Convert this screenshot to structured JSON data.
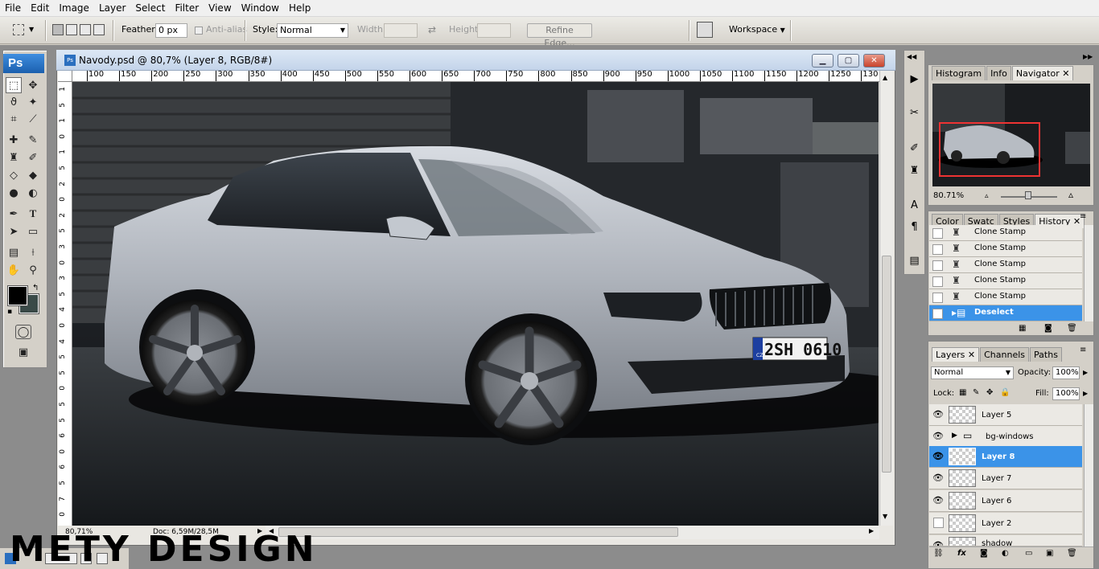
{
  "menu": [
    "File",
    "Edit",
    "Image",
    "Layer",
    "Select",
    "Filter",
    "View",
    "Window",
    "Help"
  ],
  "options": {
    "feather_label": "Feather:",
    "feather_value": "0 px",
    "antialias_label": "Anti-alias",
    "style_label": "Style:",
    "style_value": "Normal",
    "width_label": "Width:",
    "height_label": "Height:",
    "refine_edge": "Refine Edge...",
    "workspace": "Workspace"
  },
  "app_badge": "Ps",
  "document": {
    "title": "Navody.psd @ 80,7% (Layer 8, RGB/8#)",
    "zoom": "80,71%",
    "doc_size": "Doc: 6,59M/28,5M",
    "ruler_h": [
      "100",
      "150",
      "200",
      "250",
      "300",
      "350",
      "400",
      "450",
      "500",
      "550",
      "600",
      "650",
      "700",
      "750",
      "800",
      "850",
      "900",
      "950",
      "1000",
      "1050",
      "1100",
      "1150",
      "1200",
      "1250",
      "130"
    ],
    "ruler_v": [
      "1",
      "5",
      "1",
      "0",
      "1",
      "5",
      "2",
      "0",
      "2",
      "5",
      "3",
      "0",
      "3",
      "5",
      "4",
      "0",
      "4",
      "5",
      "5",
      "0",
      "5",
      "5",
      "6",
      "0",
      "6",
      "5",
      "7",
      "0"
    ],
    "plate": "2SH 0610",
    "plate_country": "CZ"
  },
  "navigator": {
    "tabs": [
      "Histogram",
      "Info",
      "Navigator"
    ],
    "zoom": "80.71%"
  },
  "history": {
    "tabs": [
      "Color",
      "Swatc",
      "Styles",
      "History"
    ],
    "items": [
      "Clone Stamp",
      "Clone Stamp",
      "Clone Stamp",
      "Clone Stamp",
      "Clone Stamp",
      "Deselect"
    ]
  },
  "layers": {
    "tabs": [
      "Layers",
      "Channels",
      "Paths"
    ],
    "blend_mode": "Normal",
    "opacity_label": "Opacity:",
    "opacity": "100%",
    "lock_label": "Lock:",
    "fill_label": "Fill:",
    "fill": "100%",
    "items": [
      "Layer 5",
      "bg-windows",
      "Layer 8",
      "Layer 7",
      "Layer 6",
      "Layer 2",
      "shadow"
    ]
  },
  "watermark": "METY DESIGN",
  "colors": {
    "accent": "#3b93e8",
    "foreground": "#000000",
    "background": "#3a4a48"
  }
}
